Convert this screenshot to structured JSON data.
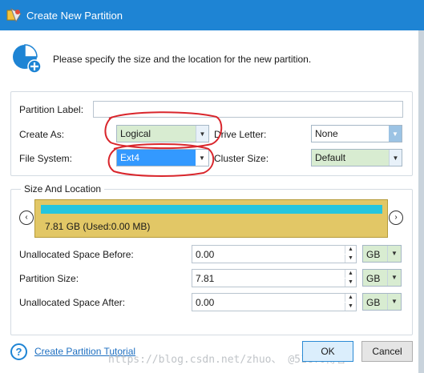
{
  "window": {
    "title": "Create New Partition"
  },
  "header": {
    "instruction": "Please specify the size and the location for the new partition."
  },
  "partition": {
    "label_caption": "Partition Label:",
    "label_value": "",
    "create_as_caption": "Create As:",
    "create_as_value": "Logical",
    "drive_letter_caption": "Drive Letter:",
    "drive_letter_value": "None",
    "file_system_caption": "File System:",
    "file_system_value": "Ext4",
    "cluster_size_caption": "Cluster Size:",
    "cluster_size_value": "Default"
  },
  "size_location": {
    "legend": "Size And Location",
    "disk_text": "7.81 GB (Used:0.00 MB)",
    "nav_left": "‹",
    "nav_right": "›",
    "rows": [
      {
        "caption": "Unallocated Space Before:",
        "value": "0.00",
        "unit": "GB"
      },
      {
        "caption": "Partition Size:",
        "value": "7.81",
        "unit": "GB"
      },
      {
        "caption": "Unallocated Space After:",
        "value": "0.00",
        "unit": "GB"
      }
    ]
  },
  "footer": {
    "tutorial_link": "Create Partition Tutorial",
    "help_glyph": "?",
    "ok_label": "OK",
    "cancel_label": "Cancel",
    "watermark": "https://blog.csdn.net/zhuo、 @51CTO博客"
  },
  "icons": {
    "app": "partition-wizard-icon",
    "header": "partition-add-icon",
    "help": "question-circle-icon"
  },
  "colors": {
    "titlebar": "#1e84d4",
    "disk_bar": "#e2c766",
    "disk_fill": "#26c5de",
    "selected": "#3399ff",
    "annotation": "#d9262c"
  }
}
